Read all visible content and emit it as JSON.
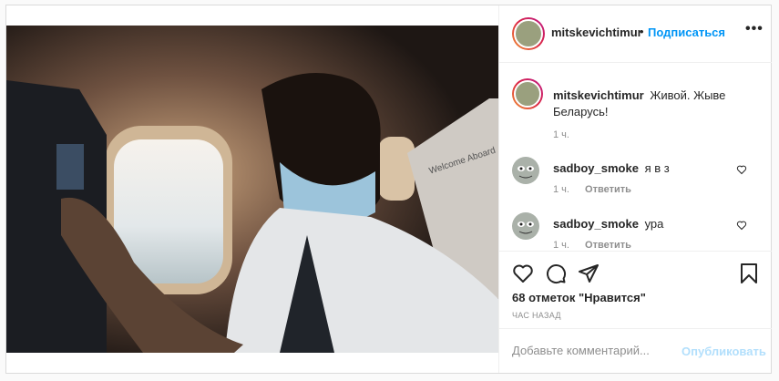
{
  "post": {
    "author": "mitskevichtimur",
    "follow_label": "Подписаться",
    "separator": "•",
    "more_label": "•••"
  },
  "caption": {
    "author": "mitskevichtimur",
    "text": "Живой. Жыве Беларусь!",
    "time": "1 ч."
  },
  "comments": [
    {
      "author": "sadboy_smoke",
      "text": "я в з",
      "time": "1 ч.",
      "reply_label": "Ответить"
    },
    {
      "author": "sadboy_smoke",
      "text": "ура",
      "time": "1 ч.",
      "reply_label": "Ответить"
    }
  ],
  "photo": {
    "seat_text": "Welcome Aboard"
  },
  "stats": {
    "likes": "68 отметок \"Нравится\"",
    "posted": "ЧАС НАЗАД"
  },
  "composer": {
    "placeholder": "Добавьте комментарий...",
    "post_label": "Опубликовать"
  },
  "colors": {
    "accent": "#0095f6",
    "muted": "#8e8e8e",
    "post_disabled": "#b2dffc"
  },
  "icons": [
    "like-icon",
    "comment-icon",
    "share-icon",
    "save-icon",
    "heart-icon",
    "more-icon"
  ]
}
